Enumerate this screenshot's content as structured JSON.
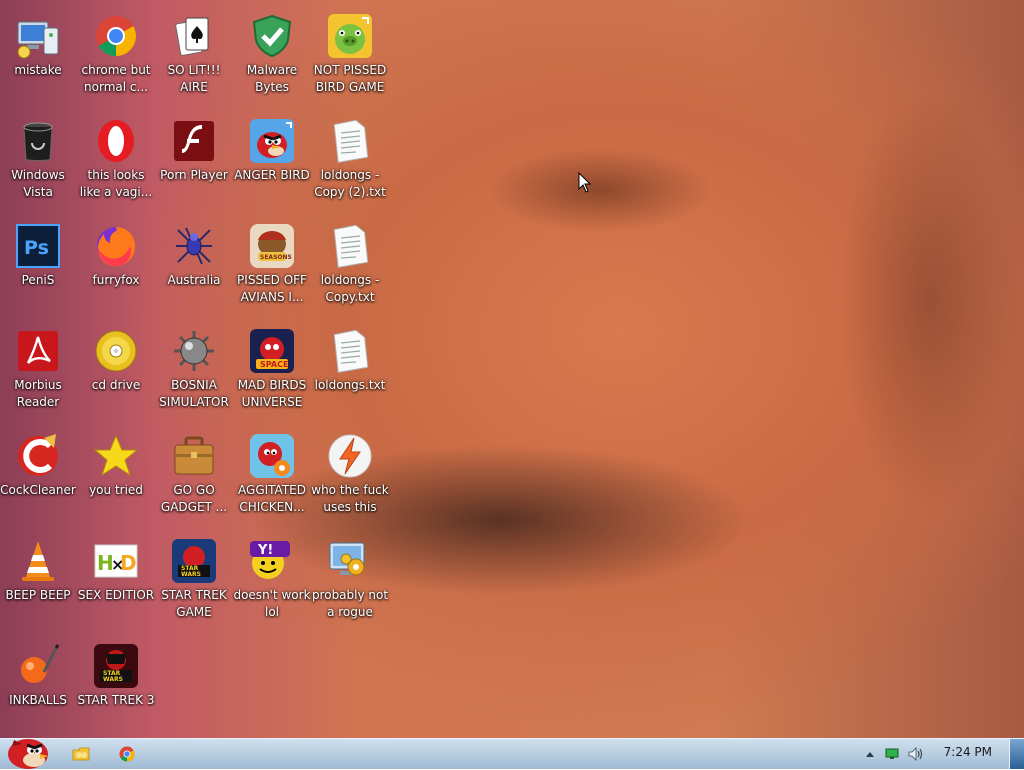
{
  "desktop": {
    "icons": [
      {
        "label": "mistake",
        "icon": "computer-icon"
      },
      {
        "label": "chrome but normal c...",
        "icon": "chrome-icon"
      },
      {
        "label": "SO LIT!!! AIRE",
        "icon": "solitaire-cards-icon"
      },
      {
        "label": "Malware Bytes",
        "icon": "shield-check-icon"
      },
      {
        "label": "NOT PISSED BIRD GAME",
        "icon": "green-pig-icon"
      },
      {
        "label": "Windows Vista",
        "icon": "recycle-bin-icon"
      },
      {
        "label": "this looks like a vagi...",
        "icon": "opera-icon"
      },
      {
        "label": "Porn Player",
        "icon": "flash-icon"
      },
      {
        "label": "ANGER BIRD",
        "icon": "red-bird-icon"
      },
      {
        "label": "loldongs - Copy (2).txt",
        "icon": "text-file-icon"
      },
      {
        "label": "PeniS",
        "icon": "photoshop-icon"
      },
      {
        "label": "furryfox",
        "icon": "firefox-icon"
      },
      {
        "label": "Australia",
        "icon": "spider-icon"
      },
      {
        "label": "PISSED OFF AVIANS I...",
        "icon": "bird-seasons-icon"
      },
      {
        "label": "loldongs - Copy.txt",
        "icon": "text-file-icon"
      },
      {
        "label": "Morbius Reader",
        "icon": "acrobat-icon"
      },
      {
        "label": "cd drive",
        "icon": "cd-icon"
      },
      {
        "label": "BOSNIA SIMULATOR",
        "icon": "mine-icon"
      },
      {
        "label": "MAD BIRDS UNIVERSE",
        "icon": "bird-space-icon"
      },
      {
        "label": "loldongs.txt",
        "icon": "text-file-icon"
      },
      {
        "label": "CockCleaner",
        "icon": "ccleaner-icon"
      },
      {
        "label": "you tried",
        "icon": "star-icon"
      },
      {
        "label": "GO GO GADGET ...",
        "icon": "briefcase-icon"
      },
      {
        "label": "AGGITATED CHICKEN...",
        "icon": "bird-rio-icon"
      },
      {
        "label": "who the fuck uses this",
        "icon": "avast-lightning-icon"
      },
      {
        "label": "BEEP BEEP",
        "icon": "vlc-cone-icon"
      },
      {
        "label": "SEX EDITIOR",
        "icon": "hxd-icon"
      },
      {
        "label": "STAR TREK GAME",
        "icon": "star-wars-bird-icon"
      },
      {
        "label": "doesn't work lol",
        "icon": "yahoo-icon"
      },
      {
        "label": "probably not a rogue",
        "icon": "control-panel-icon"
      },
      {
        "label": "INKBALLS",
        "icon": "inkball-icon"
      },
      {
        "label": "STAR TREK 3",
        "icon": "star-wars-bird-2-icon"
      }
    ]
  },
  "taskbar": {
    "start_icon": "angry-bird-start-icon",
    "pinned": [
      {
        "name": "explorer",
        "icon": "folder-icon"
      },
      {
        "name": "chrome",
        "icon": "chrome-icon"
      }
    ],
    "tray": {
      "clock": "7:24 PM",
      "icons": [
        "show-hidden-icon",
        "network-icon",
        "volume-icon"
      ]
    }
  }
}
